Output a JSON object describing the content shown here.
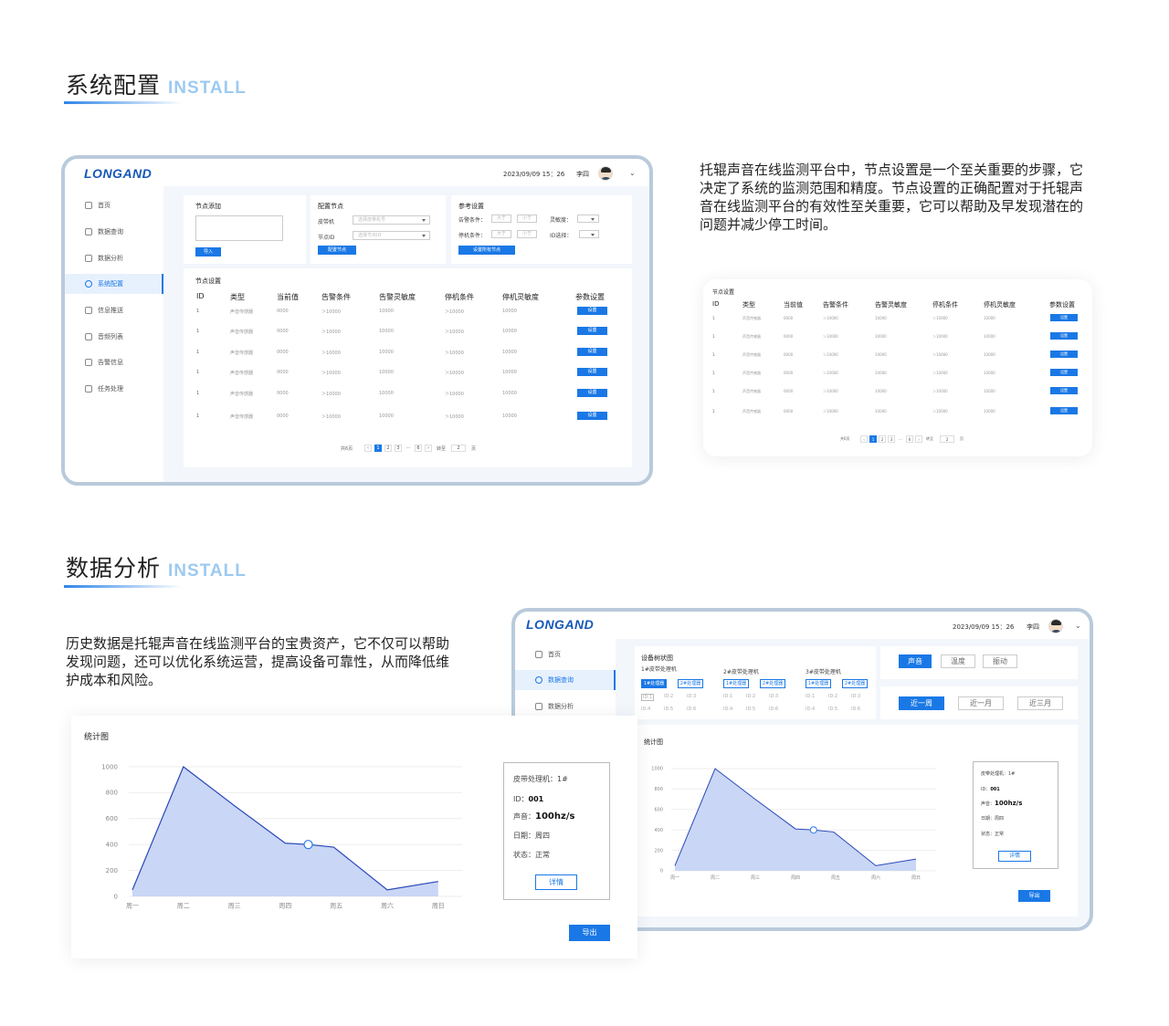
{
  "section1": {
    "title": "系统配置",
    "en": "INSTALL"
  },
  "section2": {
    "title": "数据分析",
    "en": "INSTALL"
  },
  "para1": "托辊声音在线监测平台中，节点设置是一个至关重要的步骤，它决定了系统的监测范围和精度。节点设置的正确配置对于托辊声音在线监测平台的有效性至关重要，它可以帮助及早发现潜在的问题并减少停工时间。",
  "para2": "历史数据是托辊声音在线监测平台的宝贵资产，它不仅可以帮助发现问题，还可以优化系统运营，提高设备可靠性，从而降低维护成本和风险。",
  "app": {
    "logo": "LONGAND",
    "datetime": "2023/09/09   15：26",
    "user": "李四",
    "colors": {
      "accent": "#1a78e6",
      "frame": "#b9cadb",
      "fill": "#c9d6f5",
      "line": "#2a48b8"
    }
  },
  "sidebar": {
    "items": [
      {
        "label": "首页",
        "icon": "home-icon"
      },
      {
        "label": "数据查询",
        "icon": "search-doc-icon"
      },
      {
        "label": "数据分析",
        "icon": "analysis-icon"
      },
      {
        "label": "系统配置",
        "icon": "settings-icon"
      },
      {
        "label": "信息推送",
        "icon": "message-icon"
      },
      {
        "label": "音频列表",
        "icon": "audio-list-icon"
      },
      {
        "label": "告警信息",
        "icon": "alarm-icon"
      },
      {
        "label": "任务处理",
        "icon": "task-icon"
      }
    ]
  },
  "node_add": {
    "title": "节点添加",
    "import": "导入"
  },
  "config_node": {
    "title": "配置节点",
    "belt_label": "皮带机",
    "belt_placeholder": "选择皮带机号",
    "node_label": "节点ID",
    "node_placeholder": "选择节点ID",
    "button": "配置节点"
  },
  "ref_settings": {
    "title": "参考设置",
    "alarm_label": "告警条件：",
    "stop_label": "停机条件：",
    "gt": "大于",
    "lt": "小于",
    "sens_label": "灵敏度：",
    "id_label": "ID选择：",
    "button": "设置所有节点"
  },
  "node_table": {
    "title": "节点设置",
    "headers": [
      "ID",
      "类型",
      "当前值",
      "告警条件",
      "告警灵敏度",
      "停机条件",
      "停机灵敏度",
      "参数设置"
    ],
    "rows": [
      [
        "1",
        "声音传感器",
        "0000",
        "＞10000",
        "10000",
        "＞10000",
        "10000"
      ],
      [
        "1",
        "声音传感器",
        "0000",
        "＞10000",
        "10000",
        "＞10000",
        "10000"
      ],
      [
        "1",
        "声音传感器",
        "0000",
        "＞10000",
        "10000",
        "＞10000",
        "10000"
      ],
      [
        "1",
        "声音传感器",
        "0000",
        "＞10000",
        "10000",
        "＞10000",
        "10000"
      ],
      [
        "1",
        "声音传感器",
        "0000",
        "＞10000",
        "10000",
        "＞10000",
        "10000"
      ],
      [
        "1",
        "声音传感器",
        "0000",
        "＞10000",
        "10000",
        "＞10000",
        "10000"
      ]
    ],
    "action": "设置"
  },
  "pagination": {
    "total": "共6页",
    "prev": "‹",
    "pages": [
      "1",
      "2",
      "3",
      "...",
      "6"
    ],
    "next": "›",
    "goto": "转至",
    "page_input": "2",
    "page_unit": "页"
  },
  "analysis": {
    "tree_title": "设备树状图",
    "machines": [
      {
        "name": "1#皮带处理机",
        "chips": [
          "1#处理器",
          "2#处理器"
        ],
        "ids": [
          "ID:1",
          "ID:2",
          "ID:3",
          "ID:4",
          "ID:5",
          "ID:6"
        ]
      },
      {
        "name": "2#皮带处理机",
        "chips": [
          "1#处理器",
          "2#处理器"
        ],
        "ids": [
          "ID:1",
          "ID:2",
          "ID:3",
          "ID:4",
          "ID:5",
          "ID:6"
        ]
      },
      {
        "name": "3#皮带处理机",
        "chips": [
          "1#处理器",
          "2#处理器"
        ],
        "ids": [
          "ID:1",
          "ID:2",
          "ID:3",
          "ID:4",
          "ID:5",
          "ID:6"
        ]
      }
    ],
    "type_tabs": [
      "声音",
      "温度",
      "振动"
    ],
    "range_tabs": [
      "近一周",
      "近一月",
      "近三月"
    ],
    "chart_title": "统计图",
    "info": {
      "machine": "皮带处理机：1#",
      "id_label": "ID：",
      "id_value": "001",
      "sound_label": "声音：",
      "sound_value": "100hz/s",
      "date_label": "日期：",
      "date_value": "周四",
      "status_label": "状态：",
      "status_value": "正常"
    },
    "detail_button": "详情",
    "export_button": "导出"
  },
  "chart_data": {
    "type": "area",
    "title": "统计图",
    "categories": [
      "周一",
      "周二",
      "周三",
      "周四",
      "周五",
      "周六",
      "周日"
    ],
    "x": [
      0,
      1,
      2,
      3,
      3.45,
      3.95,
      5,
      6
    ],
    "values": [
      50,
      1000,
      700,
      410,
      400,
      380,
      50,
      115
    ],
    "highlight_index": 4,
    "yticks": [
      0,
      200,
      400,
      600,
      800,
      1000
    ],
    "ylim": [
      0,
      1000
    ],
    "grid": true,
    "xlabel": "",
    "ylabel": ""
  }
}
